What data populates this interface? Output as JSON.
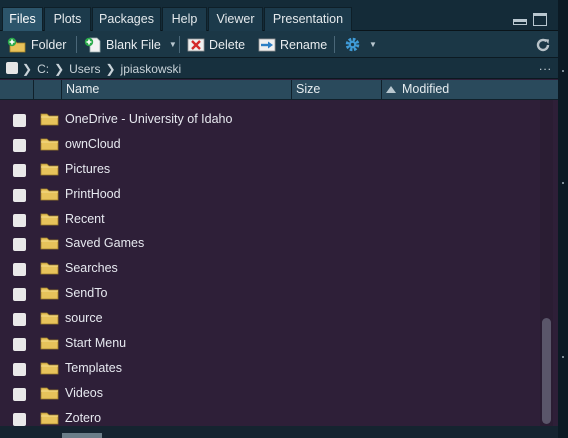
{
  "tabs": [
    {
      "label": "Files",
      "active": true
    },
    {
      "label": "Plots",
      "active": false
    },
    {
      "label": "Packages",
      "active": false
    },
    {
      "label": "Help",
      "active": false
    },
    {
      "label": "Viewer",
      "active": false
    },
    {
      "label": "Presentation",
      "active": false
    }
  ],
  "toolbar": {
    "folder_label": "Folder",
    "blank_file_label": "Blank File",
    "delete_label": "Delete",
    "rename_label": "Rename",
    "icons": [
      "new-folder-icon",
      "new-blank-file-icon",
      "delete-icon",
      "rename-icon",
      "gear-icon",
      "refresh-icon"
    ]
  },
  "path": {
    "segments": [
      "C:",
      "Users",
      "jpiaskowski"
    ],
    "more_label": "..."
  },
  "columns": {
    "name": "Name",
    "size": "Size",
    "modified": "Modified",
    "sort": "ascending"
  },
  "files": [
    {
      "name": "OneDrive - University of Idaho",
      "type": "folder"
    },
    {
      "name": "ownCloud",
      "type": "folder"
    },
    {
      "name": "Pictures",
      "type": "folder"
    },
    {
      "name": "PrintHood",
      "type": "folder"
    },
    {
      "name": "Recent",
      "type": "folder"
    },
    {
      "name": "Saved Games",
      "type": "folder"
    },
    {
      "name": "Searches",
      "type": "folder"
    },
    {
      "name": "SendTo",
      "type": "folder"
    },
    {
      "name": "source",
      "type": "folder"
    },
    {
      "name": "Start Menu",
      "type": "folder"
    },
    {
      "name": "Templates",
      "type": "folder"
    },
    {
      "name": "Videos",
      "type": "folder"
    },
    {
      "name": "Zotero",
      "type": "folder"
    }
  ],
  "colors": {
    "accent": "#2c556b",
    "list_background": "#2e1f38",
    "folder": "#e7c35b"
  }
}
